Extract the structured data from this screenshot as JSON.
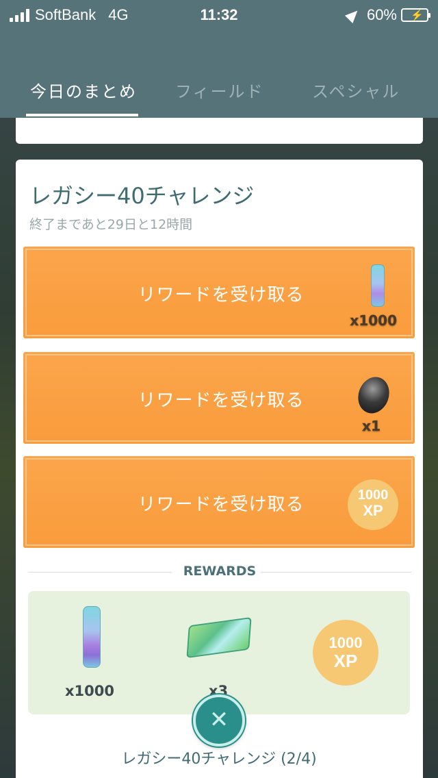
{
  "status_bar": {
    "carrier": "SoftBank",
    "network": "4G",
    "time": "11:32",
    "battery": "60%"
  },
  "tabs": [
    {
      "label": "今日のまとめ",
      "active": true
    },
    {
      "label": "フィールド",
      "active": false
    },
    {
      "label": "スペシャル",
      "active": false
    }
  ],
  "challenge": {
    "title": "レガシー40チャレンジ",
    "subtitle": "終了まであと29日と12時間"
  },
  "reward_buttons": [
    {
      "label": "リワードを受け取る",
      "icon": "stardust-spray-icon",
      "qty": "x1000"
    },
    {
      "label": "リワードを受け取る",
      "icon": "sinnoh-stone-icon",
      "qty": "x1"
    },
    {
      "label": "リワードを受け取る",
      "icon": "xp-badge-icon",
      "xp_number": "1000",
      "xp_unit": "XP"
    }
  ],
  "rewards": {
    "header": "REWARDS",
    "items": [
      {
        "icon": "stardust-spray-icon",
        "qty": "x1000"
      },
      {
        "icon": "map-ticket-icon",
        "qty": "x3"
      },
      {
        "icon": "xp-badge-icon",
        "xp_number": "1000",
        "xp_unit": "XP"
      }
    ]
  },
  "footer": {
    "title": "レガシー40チャレンジ (2/4)"
  },
  "colors": {
    "header_bg": "#56737a",
    "reward_orange": "#f99d3c",
    "xp_gold": "#f6c873",
    "close_teal": "#2a8f8b",
    "title_teal": "#3f6b72"
  }
}
